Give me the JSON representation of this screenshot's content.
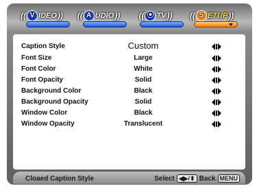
{
  "tabs": [
    {
      "id": "video",
      "circle": "V",
      "label": "IDEO"
    },
    {
      "id": "audio",
      "circle": "A",
      "label": "UDIO"
    },
    {
      "id": "tv",
      "circle": "⦿",
      "label": "TV"
    },
    {
      "id": "setup",
      "circle": "S",
      "label": "ETUP"
    }
  ],
  "active_tab": "setup",
  "rows": [
    {
      "label": "Caption Style",
      "value": "Custom"
    },
    {
      "label": "Font Size",
      "value": "Large"
    },
    {
      "label": "Font Color",
      "value": "White"
    },
    {
      "label": "Font Opacity",
      "value": "Solid"
    },
    {
      "label": "Background Color",
      "value": "Black"
    },
    {
      "label": "Background Opacity",
      "value": "Solid"
    },
    {
      "label": "Window Color",
      "value": "Black"
    },
    {
      "label": "Window Opacity",
      "value": "Translucent"
    }
  ],
  "footer": {
    "title": "Cloaed Caption Style",
    "select_label": "Select",
    "select_key": "◀▶/⬍",
    "back_label": "Back",
    "back_key": "MENU"
  },
  "colors": {
    "tab_circle": "#1d3fc5",
    "setup_circle": "#ff8a00",
    "setup_text": "#ffe63c",
    "bar_blue": "#1b56d8",
    "bar_orange": "#ff7a00"
  }
}
